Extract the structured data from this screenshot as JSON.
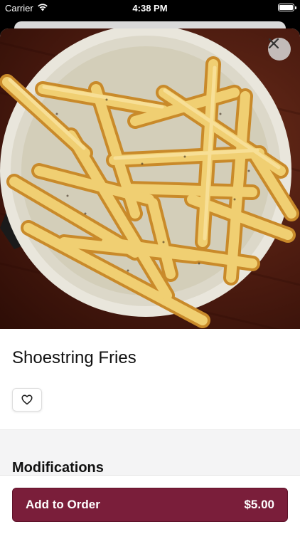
{
  "status_bar": {
    "carrier": "Carrier",
    "time": "4:38 PM"
  },
  "item": {
    "name": "Shoestring Fries",
    "image_alt": "",
    "favorite_icon": "heart-icon",
    "close_icon": "close-icon"
  },
  "sections": {
    "modifications_title": "Modifications"
  },
  "order_button": {
    "label": "Add to Order",
    "price": "$5.00"
  },
  "colors": {
    "accent": "#7a1e3a",
    "background": "#ffffff",
    "section_bg": "#f4f4f5"
  }
}
